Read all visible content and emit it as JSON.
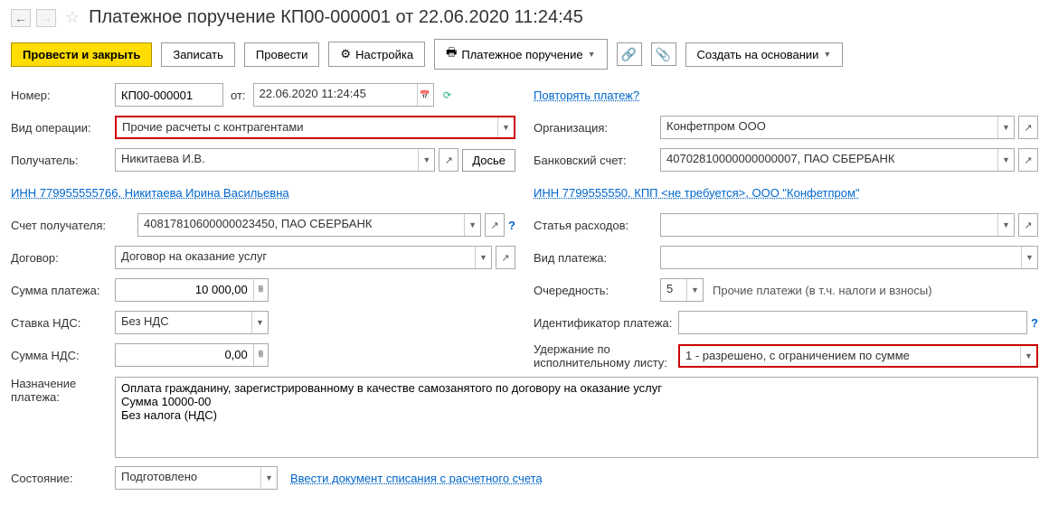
{
  "header": {
    "title": "Платежное поручение КП00-000001 от 22.06.2020 11:24:45"
  },
  "toolbar": {
    "post_close": "Провести и закрыть",
    "save": "Записать",
    "post": "Провести",
    "settings": "Настройка",
    "print": "Платежное поручение",
    "create_based": "Создать на основании"
  },
  "left": {
    "number_label": "Номер:",
    "number_value": "КП00-000001",
    "from_label": "от:",
    "date_value": "22.06.2020 11:24:45",
    "op_type_label": "Вид операции:",
    "op_type_value": "Прочие расчеты с контрагентами",
    "recipient_label": "Получатель:",
    "recipient_value": "Никитаева И.В.",
    "dossier_btn": "Досье",
    "inn_link": "ИНН 779955555766, Никитаева Ирина Васильевна",
    "recipient_acc_label": "Счет получателя:",
    "recipient_acc_value": "40817810600000023450, ПАО СБЕРБАНК",
    "contract_label": "Договор:",
    "contract_value": "Договор на оказание услуг",
    "sum_label": "Сумма платежа:",
    "sum_value": "10 000,00",
    "vat_rate_label": "Ставка НДС:",
    "vat_rate_value": "Без НДС",
    "vat_sum_label": "Сумма НДС:",
    "vat_sum_value": "0,00"
  },
  "right": {
    "repeat_link": "Повторять платеж?",
    "org_label": "Организация:",
    "org_value": "Конфетпром ООО",
    "bank_acc_label": "Банковский счет:",
    "bank_acc_value": "40702810000000000007, ПАО СБЕРБАНК",
    "inn_link": "ИНН 7799555550, КПП <не требуется>, ООО \"Конфетпром\"",
    "expense_label": "Статья расходов:",
    "expense_value": "",
    "pay_type_label": "Вид платежа:",
    "pay_type_value": "",
    "priority_label": "Очередность:",
    "priority_value": "5",
    "priority_hint": "Прочие платежи (в т.ч. налоги и взносы)",
    "ident_label": "Идентификатор платежа:",
    "ident_value": "",
    "withhold_label": "Удержание по исполнительному листу:",
    "withhold_value": "1 - разрешено, с ограничением по сумме"
  },
  "bottom": {
    "purpose_label": "Назначение платежа:",
    "purpose_value": "Оплата гражданину, зарегистрированному в качестве самозанятого по договору на оказание услуг\nСумма 10000-00\nБез налога (НДС)",
    "state_label": "Состояние:",
    "state_value": "Подготовлено",
    "writeoff_link": "Ввести документ списания с расчетного счета"
  }
}
